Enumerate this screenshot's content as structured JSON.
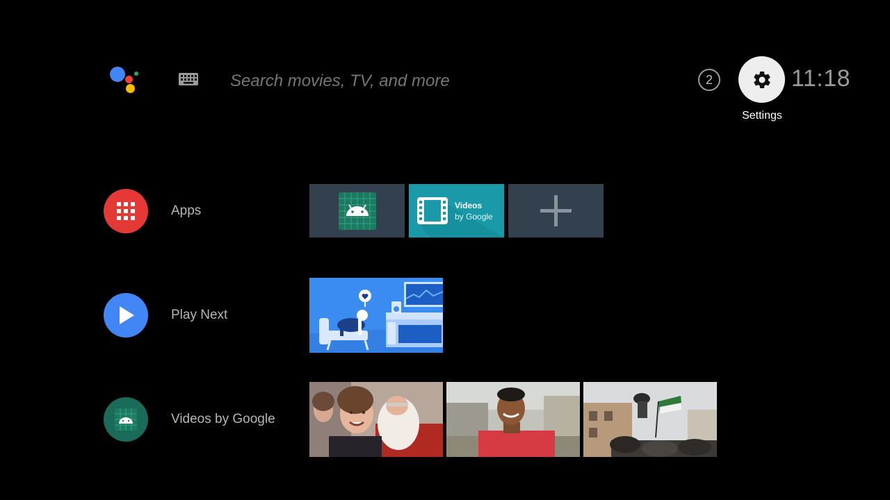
{
  "search": {
    "placeholder": "Search movies, TV, and more"
  },
  "notifications": {
    "count": "2"
  },
  "settings": {
    "label": "Settings"
  },
  "clock": {
    "time": "11:18"
  },
  "rows": {
    "apps": {
      "title": "Apps"
    },
    "play_next": {
      "title": "Play Next"
    },
    "videos": {
      "title": "Videos by Google"
    }
  },
  "apps": {
    "videos_tile": {
      "title": "Videos",
      "subtitle": "by Google"
    }
  },
  "colors": {
    "assistant_blue": "#4285f4",
    "assistant_red": "#ea4335",
    "assistant_yellow": "#fbbc04",
    "assistant_green": "#34a853",
    "apps_red": "#e53935",
    "play_blue": "#4285f4",
    "android_green": "#1b6b5a",
    "videos_teal": "#1a9aa8",
    "tile_bg": "#33404e"
  },
  "icons": [
    "assistant-icon",
    "keyboard-icon",
    "gear-icon",
    "apps-grid-icon",
    "play-icon",
    "android-icon",
    "film-icon",
    "plus-icon"
  ]
}
